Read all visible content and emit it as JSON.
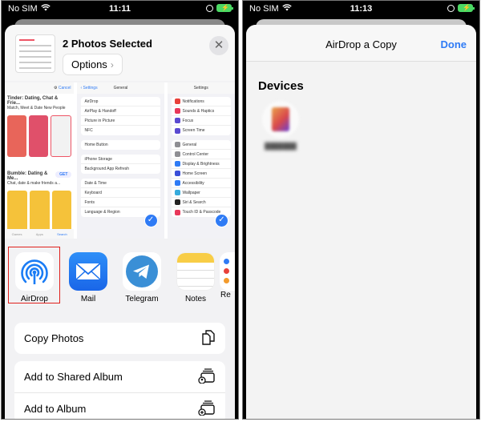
{
  "left_phone": {
    "status": {
      "carrier": "No SIM",
      "time": "11:11"
    },
    "share_sheet": {
      "title": "2 Photos Selected",
      "options_label": "Options",
      "close_label": "✕",
      "preview_appstore": {
        "cancel": "Cancel",
        "apps": [
          {
            "name": "Tinder: Dating, Chat & Frie...",
            "subtitle": "Match, Meet & Date New People"
          },
          {
            "name": "Bumble: Dating & Me...",
            "subtitle": "Chat, date & make friends a...",
            "button": "GET"
          }
        ],
        "tabs": [
          "Games",
          "Apps",
          "Search"
        ]
      },
      "preview_general": {
        "back": "Settings",
        "title": "General",
        "groups": [
          [
            "AirDrop",
            "AirPlay & Handoff",
            "Picture in Picture",
            "NFC"
          ],
          [
            "Home Button"
          ],
          [
            "iPhone Storage",
            "Background App Refresh"
          ],
          [
            "Date & Time",
            "Keyboard",
            "Fonts",
            "Language & Region"
          ]
        ]
      },
      "preview_settings": {
        "title": "Settings",
        "groups": [
          [
            {
              "label": "Notifications",
              "color": "#e8403a"
            },
            {
              "label": "Sounds & Haptics",
              "color": "#e8385a"
            },
            {
              "label": "Focus",
              "color": "#5a4ad1"
            },
            {
              "label": "Screen Time",
              "color": "#5a4ad1"
            }
          ],
          [
            {
              "label": "General",
              "color": "#8e8e93"
            },
            {
              "label": "Control Center",
              "color": "#8e8e93"
            },
            {
              "label": "Display & Brightness",
              "color": "#2f7bf5"
            },
            {
              "label": "Home Screen",
              "color": "#3a4fd8"
            },
            {
              "label": "Accessibility",
              "color": "#2f7bf5"
            },
            {
              "label": "Wallpaper",
              "color": "#36aadc"
            },
            {
              "label": "Siri & Search",
              "color": "#222"
            },
            {
              "label": "Touch ID & Passcode",
              "color": "#e8385a"
            }
          ]
        ]
      },
      "apps": [
        {
          "label": "AirDrop",
          "icon": "airdrop-icon"
        },
        {
          "label": "Mail",
          "icon": "mail-icon"
        },
        {
          "label": "Telegram",
          "icon": "telegram-icon"
        },
        {
          "label": "Notes",
          "icon": "notes-icon"
        },
        {
          "label": "Re",
          "icon": "reminders-icon"
        }
      ],
      "actions": [
        {
          "label": "Copy Photos",
          "icon": "copy-icon"
        },
        {
          "label": "Add to Shared Album",
          "icon": "shared-album-icon"
        },
        {
          "label": "Add to Album",
          "icon": "add-album-icon"
        }
      ]
    }
  },
  "right_phone": {
    "status": {
      "carrier": "No SIM",
      "time": "11:13"
    },
    "airdrop_sheet": {
      "title": "AirDrop a Copy",
      "done_label": "Done",
      "section_title": "Devices"
    }
  },
  "colors": {
    "accent": "#2f7bf5",
    "highlight": "#e0201c",
    "battery": "#4cd964"
  }
}
